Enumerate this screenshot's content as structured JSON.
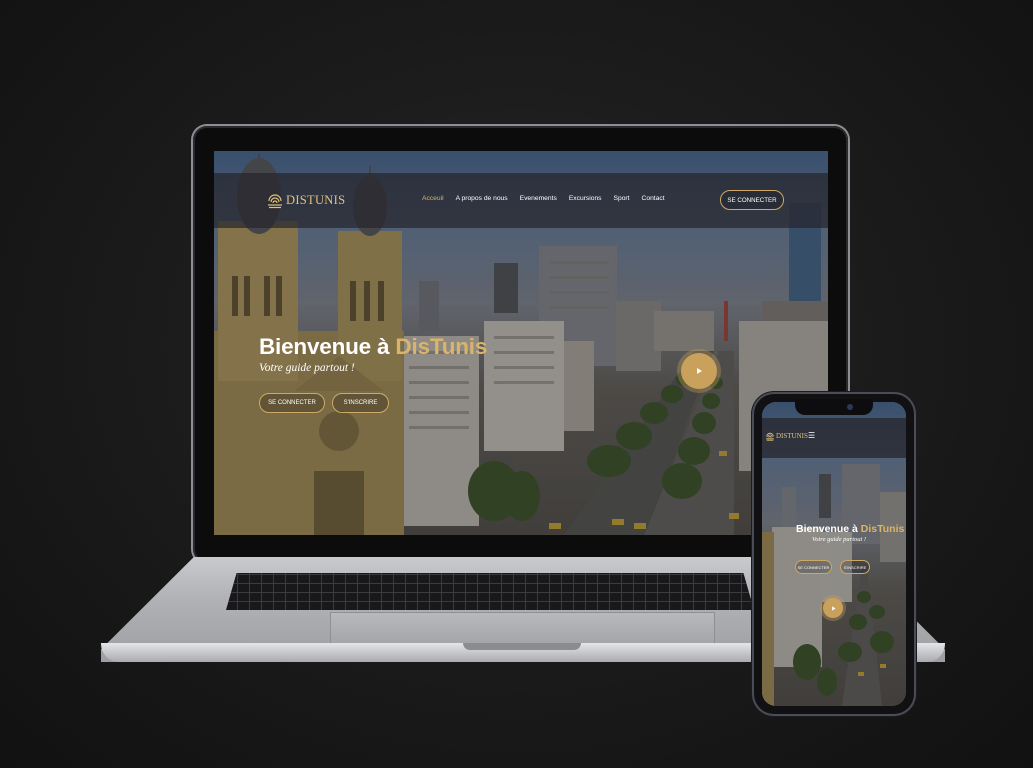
{
  "site": {
    "brand_name": "DISTUNIS",
    "nav": [
      "Acceuil",
      "A propos de nous",
      "Evenements",
      "Excursions",
      "Sport",
      "Contact"
    ],
    "active_nav_index": 0,
    "login_label": "SE CONNECTER",
    "hero": {
      "title_prefix": "Bienvenue à",
      "title_brand": "DisTunis",
      "subtitle": "Votre guide partout !",
      "primary_button": "SE CONNECTER",
      "secondary_button": "S'INSCRIRE"
    }
  },
  "icons": {
    "logo": "fingerprint-logo-icon",
    "play": "play-icon",
    "menu": "hamburger-menu-icon"
  },
  "colors": {
    "accent_gold": "#d9b46a",
    "nav_bg": "#26262c",
    "page_bg": "#1a1a1a"
  }
}
